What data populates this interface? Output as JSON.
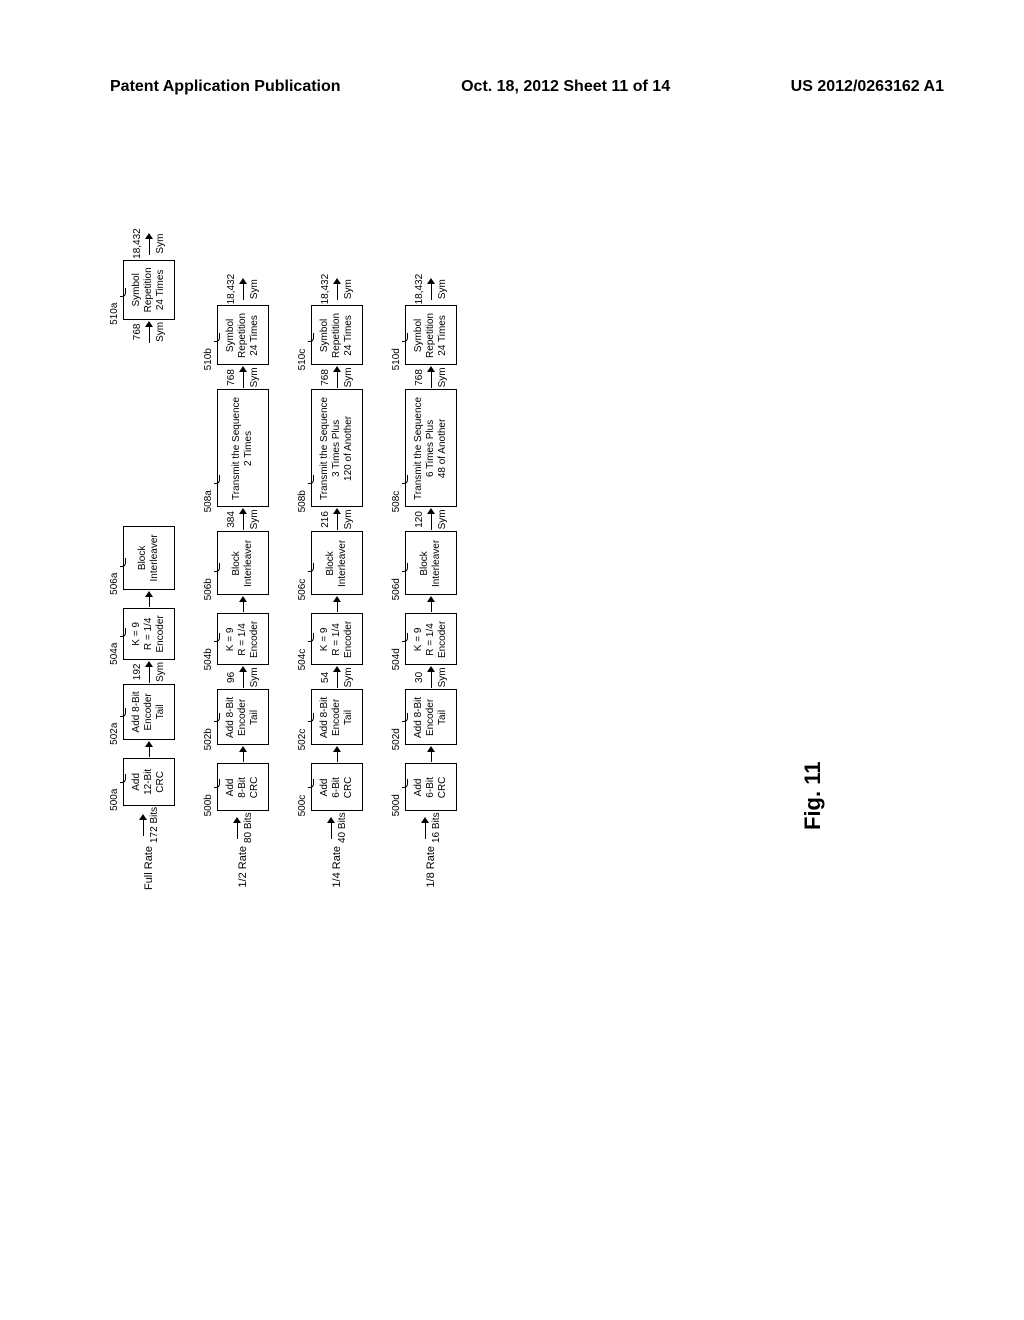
{
  "header": {
    "left": "Patent Application Publication",
    "center": "Oct. 18, 2012  Sheet 11 of 14",
    "right": "US 2012/0263162 A1"
  },
  "figure_label": "Fig. 11",
  "rows": [
    {
      "input": {
        "rate": "Full Rate",
        "bits": "172 Bits"
      },
      "crc": {
        "ref": "500a",
        "lines": [
          "Add",
          "12-Bit",
          "CRC"
        ]
      },
      "sym1": "192",
      "tail": {
        "ref": "502a",
        "lines": [
          "Add 8-Bit",
          "Encoder",
          "Tail"
        ]
      },
      "enc": {
        "ref": "504a",
        "lines": [
          "K = 9",
          "R = 1/4",
          "Encoder"
        ]
      },
      "int": {
        "ref": "506a",
        "lines": [
          "Block",
          "Interleaver"
        ]
      },
      "sym3": null,
      "xmit": null,
      "sym4": "768",
      "rep": {
        "ref": "510a",
        "lines": [
          "Symbol",
          "Repetition",
          "24 Times"
        ]
      },
      "sym5": "18,432"
    },
    {
      "input": {
        "rate": "1/2 Rate",
        "bits": "80 Bits"
      },
      "crc": {
        "ref": "500b",
        "lines": [
          "Add",
          "8-Bit",
          "CRC"
        ]
      },
      "sym1": "96",
      "tail": {
        "ref": "502b",
        "lines": [
          "Add 8-Bit",
          "Encoder",
          "Tail"
        ]
      },
      "enc": {
        "ref": "504b",
        "lines": [
          "K = 9",
          "R = 1/4",
          "Encoder"
        ]
      },
      "int": {
        "ref": "506b",
        "lines": [
          "Block",
          "Interleaver"
        ]
      },
      "sym3": "384",
      "xmit": {
        "ref": "508a",
        "lines": [
          "Transmit the Sequence",
          "2 Times"
        ]
      },
      "sym4": "768",
      "rep": {
        "ref": "510b",
        "lines": [
          "Symbol",
          "Repetition",
          "24 Times"
        ]
      },
      "sym5": "18,432"
    },
    {
      "input": {
        "rate": "1/4 Rate",
        "bits": "40 Bits"
      },
      "crc": {
        "ref": "500c",
        "lines": [
          "Add",
          "6-Bit",
          "CRC"
        ]
      },
      "sym1": "54",
      "tail": {
        "ref": "502c",
        "lines": [
          "Add 8-Bit",
          "Encoder",
          "Tail"
        ]
      },
      "enc": {
        "ref": "504c",
        "lines": [
          "K = 9",
          "R = 1/4",
          "Encoder"
        ]
      },
      "int": {
        "ref": "506c",
        "lines": [
          "Block",
          "Interleaver"
        ]
      },
      "sym3": "216",
      "xmit": {
        "ref": "508b",
        "lines": [
          "Transmit the Sequence",
          "3 Times Plus",
          "120 of Another"
        ]
      },
      "sym4": "768",
      "rep": {
        "ref": "510c",
        "lines": [
          "Symbol",
          "Repetition",
          "24 Times"
        ]
      },
      "sym5": "18,432"
    },
    {
      "input": {
        "rate": "1/8 Rate",
        "bits": "16 Bits"
      },
      "crc": {
        "ref": "500d",
        "lines": [
          "Add",
          "6-Bit",
          "CRC"
        ]
      },
      "sym1": "30",
      "tail": {
        "ref": "502d",
        "lines": [
          "Add 8-Bit",
          "Encoder",
          "Tail"
        ]
      },
      "enc": {
        "ref": "504d",
        "lines": [
          "K = 9",
          "R = 1/4",
          "Encoder"
        ]
      },
      "int": {
        "ref": "506d",
        "lines": [
          "Block",
          "Interleaver"
        ]
      },
      "sym3": "120",
      "xmit": {
        "ref": "508c",
        "lines": [
          "Transmit the Sequence",
          "6 Times Plus",
          "48 of Another"
        ]
      },
      "sym4": "768",
      "rep": {
        "ref": "510d",
        "lines": [
          "Symbol",
          "Repetition",
          "24 Times"
        ]
      },
      "sym5": "18,432"
    }
  ],
  "sym_unit": "Sym"
}
